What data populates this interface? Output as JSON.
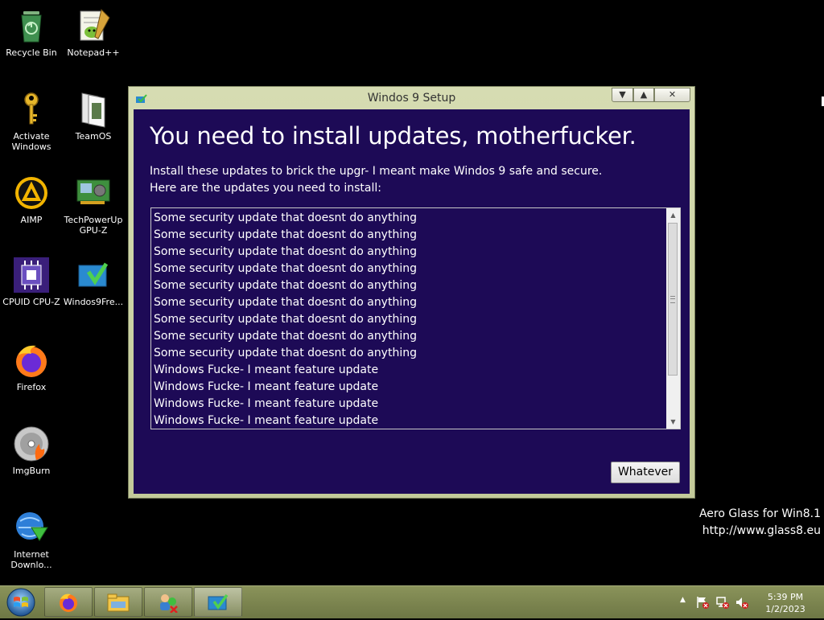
{
  "desktop": {
    "icons": [
      {
        "label": "Recycle Bin",
        "icon": "recycle-bin-icon"
      },
      {
        "label": "Notepad++",
        "icon": "notepad-plus-plus-icon"
      },
      {
        "label": "Activate Windows",
        "icon": "key-icon"
      },
      {
        "label": "TeamOS",
        "icon": "teamos-icon"
      },
      {
        "label": "AIMP",
        "icon": "aimp-icon"
      },
      {
        "label": "TechPowerUp GPU-Z",
        "icon": "gpu-z-icon"
      },
      {
        "label": "CPUID CPU-Z",
        "icon": "cpu-z-icon"
      },
      {
        "label": "Windos9Fre...",
        "icon": "windos9-setup-icon"
      },
      {
        "label": "Firefox",
        "icon": "firefox-icon"
      },
      {
        "label": "ImgBurn",
        "icon": "imgburn-icon"
      },
      {
        "label": "Internet Downlo...",
        "icon": "internet-download-manager-icon"
      }
    ],
    "watermark": {
      "line1": "Aero Glass for Win8.1",
      "line2": "http://www.glass8.eu"
    }
  },
  "window": {
    "title": "Windos 9 Setup",
    "heading": "You need to install updates, motherfucker.",
    "description_line1": "Install these updates to brick the upgr- I meant make Windos 9 safe and secure.",
    "description_line2": "Here are the updates you need to install:",
    "updates": [
      "Some security update that doesnt do anything",
      "Some security update that doesnt do anything",
      "Some security update that doesnt do anything",
      "Some security update that doesnt do anything",
      "Some security update that doesnt do anything",
      "Some security update that doesnt do anything",
      "Some security update that doesnt do anything",
      "Some security update that doesnt do anything",
      "Some security update that doesnt do anything",
      "Windows Fucke- I meant feature update",
      "Windows Fucke- I meant feature update",
      "Windows Fucke- I meant feature update",
      "Windows Fucke- I meant feature update"
    ],
    "button_label": "Whatever"
  },
  "taskbar": {
    "pinned": [
      "firefox-icon",
      "file-explorer-icon",
      "network-manager-icon",
      "windos9-setup-icon"
    ],
    "clock_time": "5:39 PM",
    "clock_date": "1/2/2023"
  },
  "colors": {
    "client_background": "#1d0a56",
    "window_frame": "#c9cfa0",
    "taskbar": "#7d8650"
  }
}
